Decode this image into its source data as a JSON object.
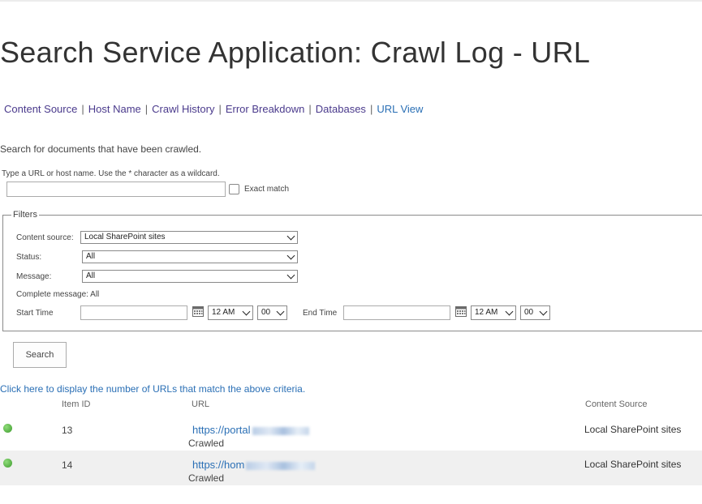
{
  "page": {
    "title": "Search Service Application: Crawl Log - URL"
  },
  "nav": {
    "items": [
      {
        "label": "Content Source"
      },
      {
        "label": "Host Name"
      },
      {
        "label": "Crawl History"
      },
      {
        "label": "Error Breakdown"
      },
      {
        "label": "Databases"
      },
      {
        "label": "URL View"
      }
    ],
    "separator": "|"
  },
  "search": {
    "intro": "Search for documents that have been crawled.",
    "hint": "Type a URL or host name. Use the * character as a wildcard.",
    "url_value": "",
    "exact_match_label": "Exact match"
  },
  "filters": {
    "legend": "Filters",
    "content_source_label": "Content source:",
    "content_source_value": "Local SharePoint sites",
    "status_label": "Status:",
    "status_value": "All",
    "message_label": "Message:",
    "message_value": "All",
    "complete_message": "Complete message: All",
    "start_time_label": "Start Time",
    "start_hour": "12 AM",
    "start_minute": "00",
    "end_time_label": "End Time",
    "end_hour": "12 AM",
    "end_minute": "00"
  },
  "actions": {
    "search_label": "Search",
    "count_link": "Click here to display the number of URLs that match the above criteria."
  },
  "table": {
    "headers": {
      "item_id": "Item ID",
      "url": "URL",
      "content_source": "Content Source"
    },
    "rows": [
      {
        "item_id": "13",
        "url": "https://portal",
        "status": "Crawled",
        "content_source": "Local SharePoint sites"
      },
      {
        "item_id": "14",
        "url": "https://hom",
        "status": "Crawled",
        "content_source": "Local SharePoint sites"
      }
    ]
  },
  "colors": {
    "link": "#2a6fb5",
    "nav_link": "#4a3a8c",
    "status_success": "#3d9b2d"
  }
}
